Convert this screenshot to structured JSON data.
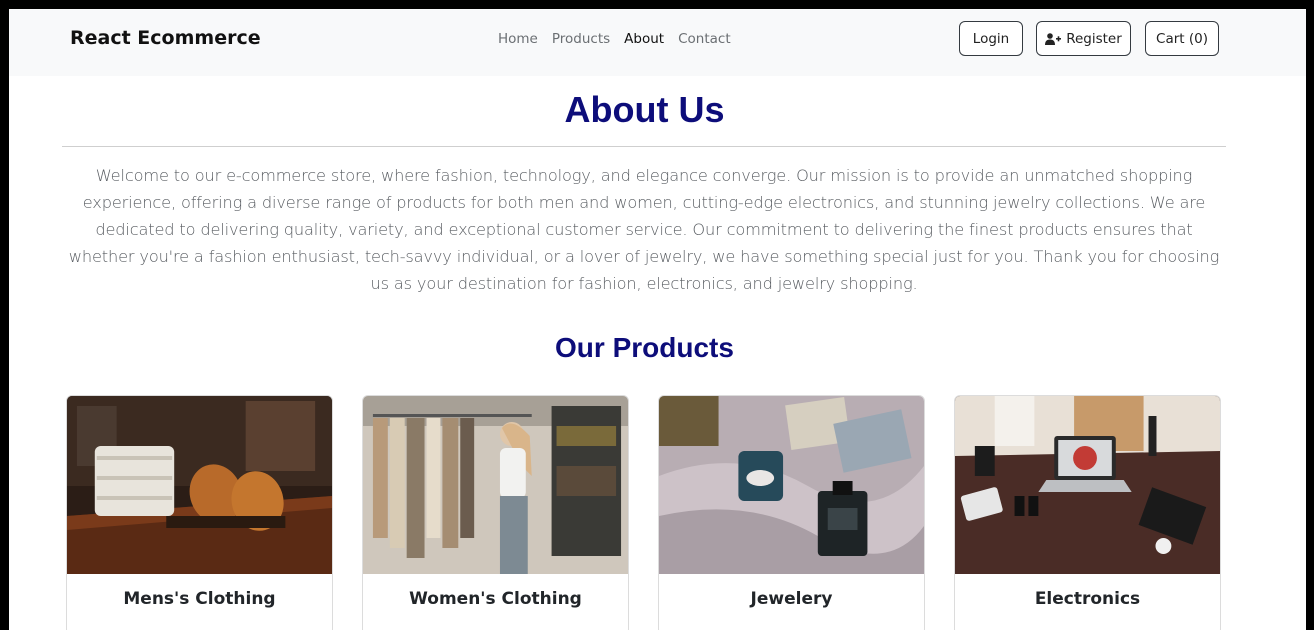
{
  "navbar": {
    "brand": "React Ecommerce",
    "links": [
      {
        "label": "Home",
        "active": false
      },
      {
        "label": "Products",
        "active": false
      },
      {
        "label": "About",
        "active": true
      },
      {
        "label": "Contact",
        "active": false
      }
    ],
    "login_label": "Login",
    "register_label": "Register",
    "register_icon": "user-plus-icon",
    "cart_label": "Cart (0)"
  },
  "about": {
    "title": "About Us",
    "text": "Welcome to our e-commerce store, where fashion, technology, and elegance converge. Our mission is to provide an unmatched shopping experience, offering a diverse range of products for both men and women, cutting-edge electronics, and stunning jewelry collections. We are dedicated to delivering quality, variety, and exceptional customer service. Our commitment to delivering the finest products ensures that whether you're a fashion enthusiast, tech-savvy individual, or a lover of jewelry, we have something special just for you. Thank you for choosing us as your destination for fashion, electronics, and jewelry shopping."
  },
  "products": {
    "title": "Our Products",
    "cards": [
      {
        "title": "Mens's Clothing"
      },
      {
        "title": "Women's Clothing"
      },
      {
        "title": "Jewelery"
      },
      {
        "title": "Electronics"
      }
    ]
  },
  "colors": {
    "heading": "#0d0d7a",
    "navbar_bg": "#f8f9fa"
  }
}
